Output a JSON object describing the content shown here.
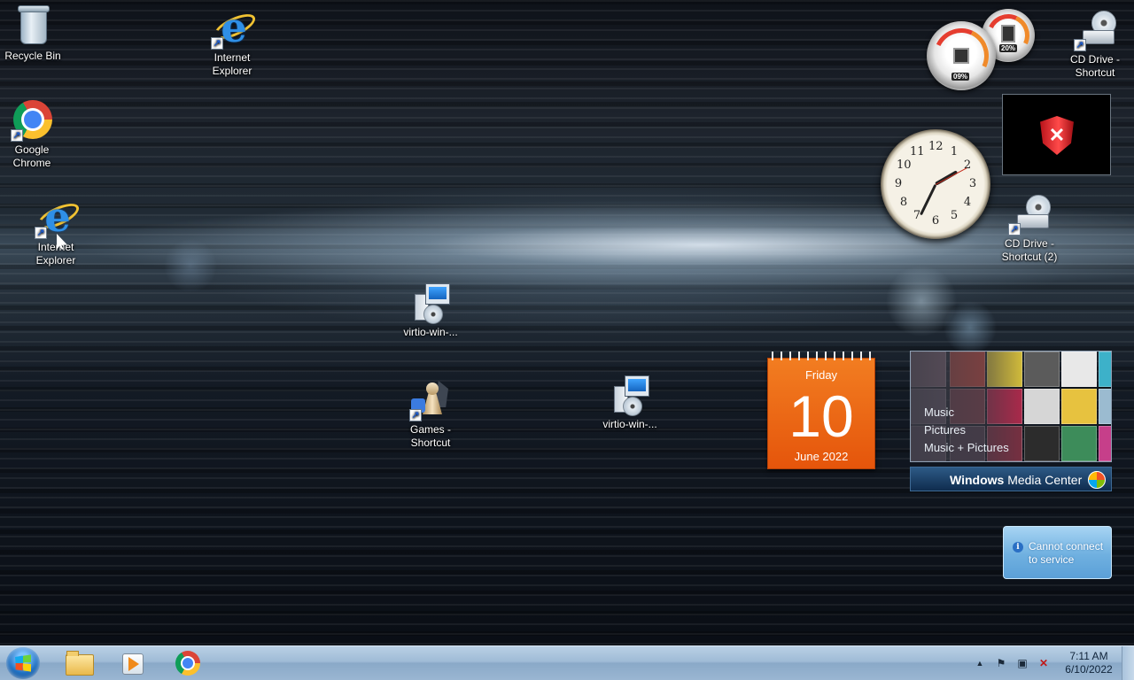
{
  "desktop": {
    "icons": [
      {
        "label": "Recycle Bin",
        "icon": "recycle-bin-icon"
      },
      {
        "label": "Internet\nExplorer",
        "icon": "internet-explorer-icon"
      },
      {
        "label": "Google\nChrome",
        "icon": "chrome-icon"
      },
      {
        "label": "Internet\nExplorer",
        "icon": "internet-explorer-icon"
      },
      {
        "label": "virtio-win-...",
        "icon": "installer-icon"
      },
      {
        "label": "Games -\nShortcut",
        "icon": "games-icon"
      },
      {
        "label": "virtio-win-...",
        "icon": "installer-icon"
      },
      {
        "label": "CD Drive -\nShortcut",
        "icon": "cd-drive-icon"
      },
      {
        "label": "CD Drive -\nShortcut (2)",
        "icon": "cd-drive-icon"
      }
    ],
    "shortcut_arrow": "↗"
  },
  "gadgets": {
    "cpu_meter": {
      "cpu_percent": "09%",
      "memory_percent": "20%"
    },
    "security": {
      "icon": "security-shield-x-icon",
      "mark": "✕"
    },
    "clock": {
      "numerals": [
        "12",
        "1",
        "2",
        "3",
        "4",
        "5",
        "6",
        "7",
        "8",
        "9",
        "10",
        "11"
      ],
      "time": "7:11"
    },
    "calendar": {
      "day_name": "Friday",
      "day_number": "10",
      "month_year": "June 2022"
    },
    "media_center": {
      "items": [
        "Music",
        "Pictures",
        "Music + Pictures"
      ],
      "title_bold": "Windows",
      "title_rest": " Media Center"
    },
    "weather_notice": {
      "icon": "info-icon",
      "icon_glyph": "i",
      "text": "Cannot connect to service"
    }
  },
  "taskbar": {
    "start_button": "start-orb",
    "pinned": [
      {
        "name": "windows-explorer",
        "icon": "folder-icon"
      },
      {
        "name": "windows-media-player",
        "icon": "media-player-icon"
      },
      {
        "name": "google-chrome",
        "icon": "chrome-icon"
      }
    ],
    "tray": {
      "show_hidden": "▲",
      "action_center": "⚑",
      "network": "▣",
      "volume": "✕"
    },
    "clock": {
      "time": "7:11 AM",
      "date": "6/10/2022"
    }
  },
  "colors": {
    "calendar_orange": "#e5550b",
    "taskbar_blue": "#9fbbd6",
    "notice_blue": "#6fb0e0"
  }
}
